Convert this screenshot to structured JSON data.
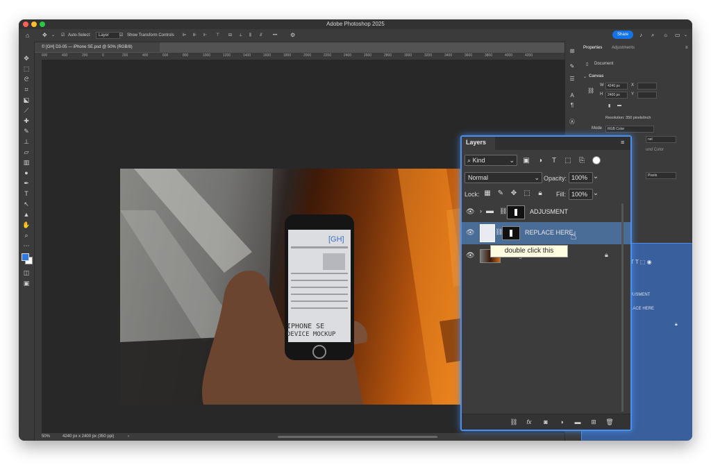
{
  "app": {
    "window_title": "Adobe Photoshop 2025"
  },
  "options_bar": {
    "auto_select_label": "Auto-Select:",
    "auto_select_value": "Layer",
    "transform_label": "Show Transform Controls",
    "more_label": "•••",
    "share_label": "Share"
  },
  "document": {
    "tab_title": "© [GH] D3-05 — iPhone SE.psd @ 50% (RGB/8)",
    "ruler_ticks": [
      "600",
      "400",
      "200",
      "0",
      "200",
      "400",
      "600",
      "800",
      "1000",
      "1200",
      "1400",
      "1600",
      "1800",
      "2000",
      "2200",
      "2400",
      "2600",
      "2800",
      "3000",
      "3200",
      "3400",
      "3600",
      "3800",
      "4000",
      "4200"
    ]
  },
  "status_bar": {
    "zoom": "50%",
    "doc_info": "4240 px x 2400 px (350 ppi)",
    "chevron": "›"
  },
  "properties": {
    "tab_properties": "Properties",
    "tab_adjustments": "Adjustments",
    "doc_label": "Document",
    "canvas_label": "Canvas",
    "w_label": "W",
    "w_value": "4240 px",
    "x_label": "X",
    "h_label": "H",
    "h_value": "2400 px",
    "y_label": "Y",
    "resolution": "Resolution: 350 pixels/inch",
    "mode_label": "Mode",
    "mode_value": "RGB Color",
    "partial_1": "nel",
    "partial_2": "und Color",
    "partial_3": "Pixels"
  },
  "layers": {
    "title": "Layers",
    "filter_kind": "Kind",
    "blend_mode": "Normal",
    "opacity_label": "Opacity:",
    "opacity_value": "100%",
    "lock_label": "Lock:",
    "fill_label": "Fill:",
    "fill_value": "100%",
    "items": [
      {
        "name": "ADJUSMENT"
      },
      {
        "name": "REPLACE HERE"
      },
      {
        "name": "Background"
      }
    ]
  },
  "tooltip": {
    "text": "double click this"
  },
  "mockup": {
    "logo": "[GH]",
    "heading_1": "IPHONE SE",
    "heading_2": "DEVICE MOCKUP"
  },
  "ghost_panel": {
    "row_1": "JUSMENT",
    "row_2": "LACE HERE"
  },
  "colors": {
    "accent": "#1473e6",
    "layers_glow": "#4a90f0",
    "selected_layer": "#4a6d98",
    "foreground_swatch": "#2f7ae0",
    "background_swatch": "#ffffff"
  }
}
